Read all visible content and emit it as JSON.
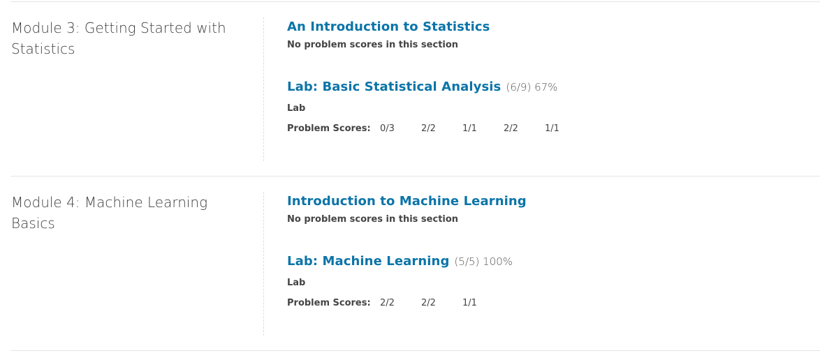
{
  "chapters": [
    {
      "title": "Module 3: Getting Started with Statistics",
      "sections": [
        {
          "title": "An Introduction to Statistics",
          "score": "",
          "note": "No problem scores in this section"
        },
        {
          "title": "Lab: Basic Statistical Analysis",
          "score": "(6/9) 67%",
          "format": "Lab",
          "problem_scores_label": "Problem Scores:",
          "problem_scores": [
            "0/3",
            "2/2",
            "1/1",
            "2/2",
            "1/1"
          ]
        }
      ]
    },
    {
      "title": "Module 4: Machine Learning Basics",
      "sections": [
        {
          "title": "Introduction to Machine Learning",
          "score": "",
          "note": "No problem scores in this section"
        },
        {
          "title": "Lab: Machine Learning",
          "score": "(5/5) 100%",
          "format": "Lab",
          "problem_scores_label": "Problem Scores:",
          "problem_scores": [
            "2/2",
            "2/2",
            "1/1"
          ]
        }
      ]
    }
  ],
  "colors": {
    "link": "#0b74a8",
    "text": "#3d3e3f",
    "rule": "#e5e5e5"
  }
}
